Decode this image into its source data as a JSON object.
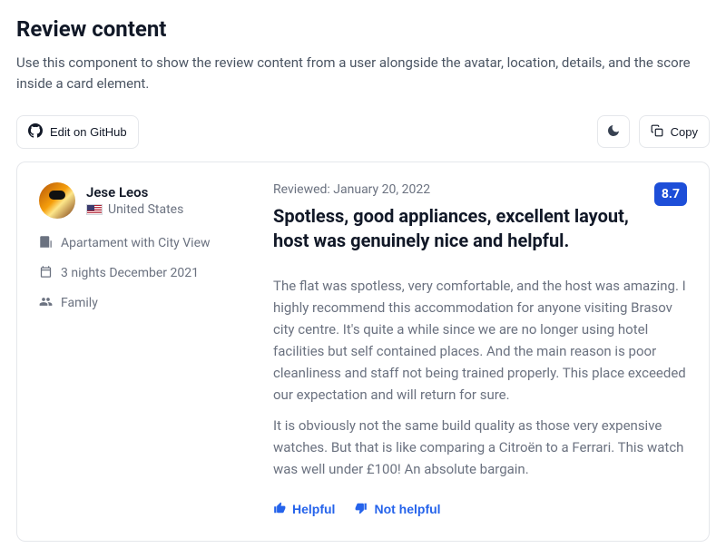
{
  "section": {
    "title": "Review content",
    "description": "Use this component to show the review content from a user alongside the avatar, location, details, and the score inside a card element."
  },
  "toolbar": {
    "edit_label": "Edit on GitHub",
    "copy_label": "Copy"
  },
  "review": {
    "user": {
      "name": "Jese Leos",
      "country": "United States"
    },
    "details": {
      "room": "Apartament with City View",
      "stay": "3 nights December 2021",
      "group": "Family"
    },
    "reviewed_prefix": "Reviewed: ",
    "reviewed_date": "January 20, 2022",
    "score": "8.7",
    "title": "Spotless, good appliances, excellent layout, host was genuinely nice and helpful.",
    "body": [
      "The flat was spotless, very comfortable, and the host was amazing. I highly recommend this accommodation for anyone visiting Brasov city centre. It's quite a while since we are no longer using hotel facilities but self contained places. And the main reason is poor cleanliness and staff not being trained properly. This place exceeded our expectation and will return for sure.",
      "It is obviously not the same build quality as those very expensive watches. But that is like comparing a Citroën to a Ferrari. This watch was well under £100! An absolute bargain."
    ],
    "feedback": {
      "helpful": "Helpful",
      "not_helpful": "Not helpful"
    }
  }
}
